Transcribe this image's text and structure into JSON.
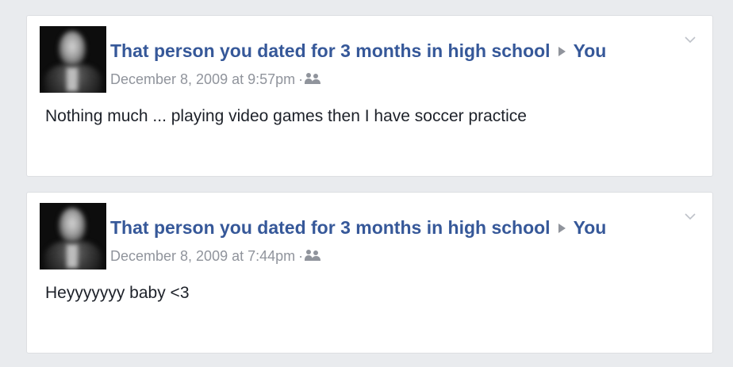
{
  "posts": [
    {
      "author": "That person you dated for 3 months in high school",
      "recipient": "You",
      "timestamp": "December 8, 2009 at 9:57pm",
      "separator": "·",
      "audience_icon": "friends-icon",
      "text": "Nothing much ... playing video games then I have soccer practice"
    },
    {
      "author": "That person you dated for 3 months in high school",
      "recipient": "You",
      "timestamp": "December 8, 2009 at 7:44pm",
      "separator": "·",
      "audience_icon": "friends-icon",
      "text": "Heyyyyyyy baby <3"
    }
  ],
  "colors": {
    "page_background": "#e9ebee",
    "card_background": "#ffffff",
    "link_blue": "#365899",
    "meta_gray": "#90949c",
    "body_text": "#1d2129"
  }
}
